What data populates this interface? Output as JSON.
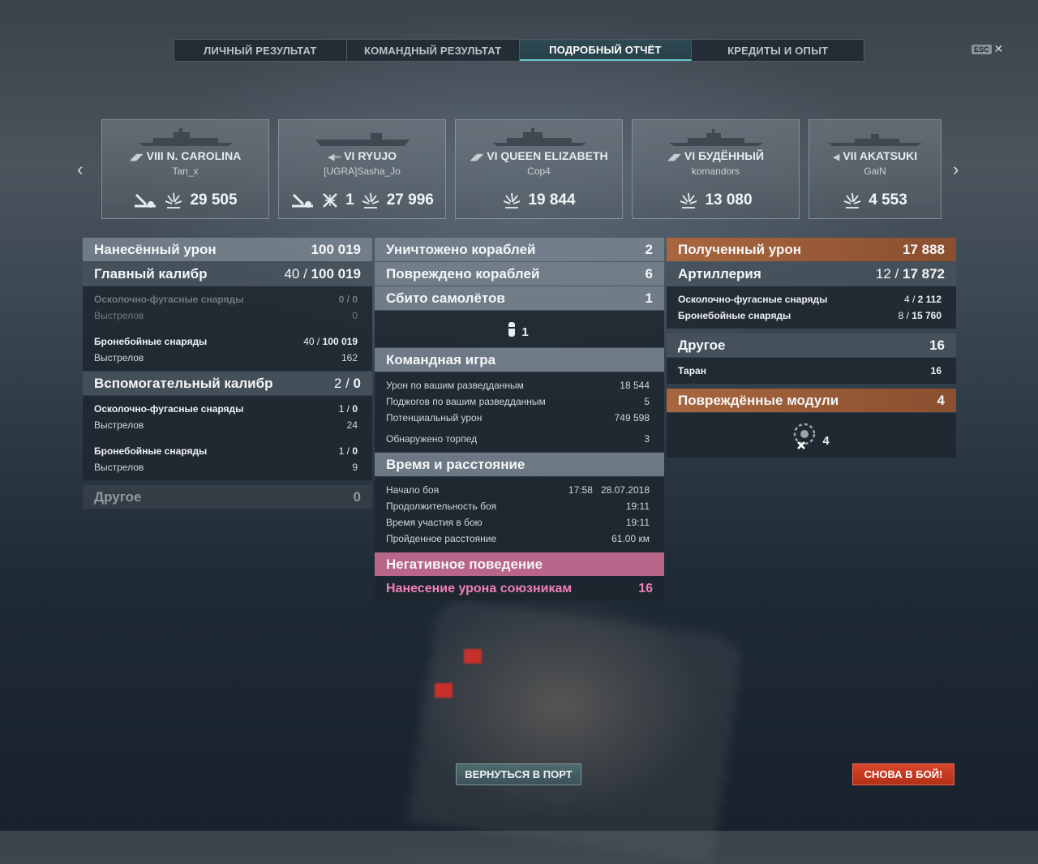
{
  "tabs": [
    "ЛИЧНЫЙ РЕЗУЛЬТАТ",
    "КОМАНДНЫЙ РЕЗУЛЬТАТ",
    "ПОДРОБНЫЙ ОТЧЁТ",
    "КРЕДИТЫ И ОПЫТ"
  ],
  "esc_label": "ESC",
  "ships": [
    {
      "tier_name": "VIII N. CAROLINA",
      "player": "Tan_x",
      "extra": "",
      "damage": "29 505"
    },
    {
      "tier_name": "VI RYUJO",
      "player": "[UGRA]Sasha_Jo",
      "extra": "1",
      "damage": "27 996"
    },
    {
      "tier_name": "VI QUEEN ELIZABETH",
      "player": "Cop4",
      "extra": "",
      "damage": "19 844"
    },
    {
      "tier_name": "VI БУДЁННЫЙ",
      "player": "komandors",
      "extra": "",
      "damage": "13 080"
    },
    {
      "tier_name": "VII AKATSUKI",
      "player": "GaiN",
      "extra": "",
      "damage": "4 553"
    }
  ],
  "dealt": {
    "title": "Нанесённый урон",
    "total": "100 019",
    "main": {
      "label": "Главный калибр",
      "hits": "40 /",
      "value": "100 019",
      "he_label": "Осколочно-фугасные снаряды",
      "he_val": "0 / 0",
      "he_shots_label": "Выстрелов",
      "he_shots": "0",
      "ap_label": "Бронебойные снаряды",
      "ap_hits": "40 /",
      "ap_val": "100 019",
      "ap_shots_label": "Выстрелов",
      "ap_shots": "162"
    },
    "secondary": {
      "label": "Вспомогательный калибр",
      "hits": "2 /",
      "value": "0",
      "he_label": "Осколочно-фугасные снаряды",
      "he_hits": "1 /",
      "he_val": "0",
      "he_shots_label": "Выстрелов",
      "he_shots": "24",
      "ap_label": "Бронебойные снаряды",
      "ap_hits": "1 /",
      "ap_val": "0",
      "ap_shots_label": "Выстрелов",
      "ap_shots": "9"
    },
    "other": {
      "label": "Другое",
      "value": "0"
    }
  },
  "middle": {
    "destroyed": {
      "label": "Уничтожено кораблей",
      "value": "2"
    },
    "damaged": {
      "label": "Повреждено кораблей",
      "value": "6"
    },
    "planes": {
      "label": "Сбито самолётов",
      "value": "1"
    },
    "bomb_count": "1",
    "team": {
      "title": "Командная игра",
      "rows": [
        {
          "label": "Урон по вашим разведданным",
          "value": "18 544"
        },
        {
          "label": "Поджогов по вашим разведданным",
          "value": "5"
        },
        {
          "label": "Потенциальный урон",
          "value": "749 598"
        },
        {
          "label": "Обнаружено торпед",
          "value": "3"
        }
      ]
    },
    "time": {
      "title": "Время и расстояние",
      "rows": [
        {
          "label": "Начало боя",
          "value": "17:58   28.07.2018"
        },
        {
          "label": "Продолжительность боя",
          "value": "19:11"
        },
        {
          "label": "Время участия в бою",
          "value": "19:11"
        },
        {
          "label": "Пройденное расстояние",
          "value": "61.00 км"
        }
      ]
    },
    "negative": {
      "title": "Негативное поведение",
      "label": "Нанесение урона союзникам",
      "value": "16"
    }
  },
  "received": {
    "title": "Полученный урон",
    "total": "17 888",
    "artillery": {
      "label": "Артиллерия",
      "hits": "12 /",
      "value": "17 872",
      "he_label": "Осколочно-фугасные снаряды",
      "he_hits": "4 /",
      "he_val": "2 112",
      "ap_label": "Бронебойные снаряды",
      "ap_hits": "8 /",
      "ap_val": "15 760"
    },
    "other": {
      "label": "Другое",
      "value": "16",
      "ram_label": "Таран",
      "ram_value": "16"
    },
    "modules": {
      "label": "Повреждённые модули",
      "value": "4",
      "icon_count": "4"
    }
  },
  "buttons": {
    "port": "ВЕРНУТЬСЯ В ПОРТ",
    "battle": "СНОВА В БОЙ!"
  },
  "colors": {
    "active_tab_accent": "#66c9c9",
    "received_header": "#a8663e",
    "negative_header": "#b8658a",
    "team_damage_text": "#f07fb7",
    "battle_button": "#c9381f"
  }
}
